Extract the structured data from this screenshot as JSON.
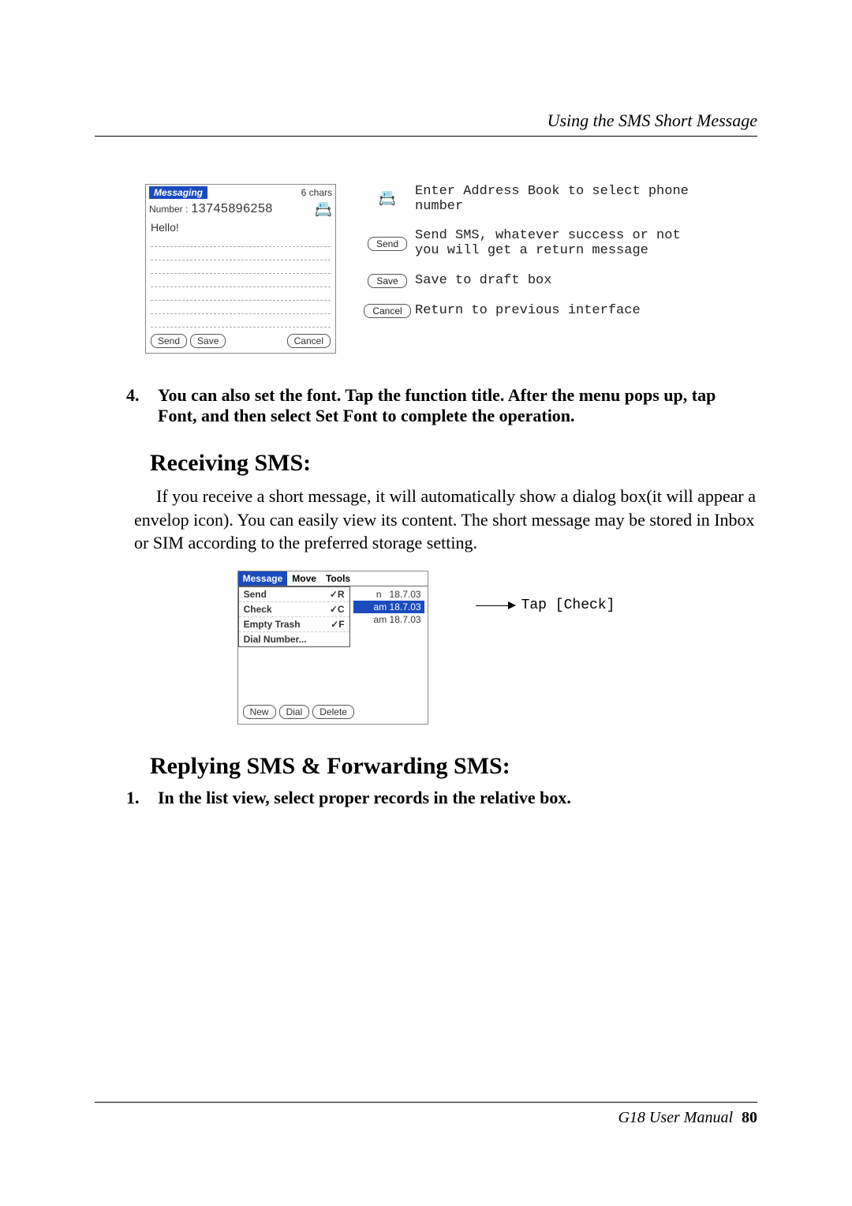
{
  "header": {
    "title": "Using the SMS Short Message"
  },
  "fig1": {
    "title": "Messaging",
    "chars": "6 chars",
    "number_label": "Number :",
    "number_value": "13745896258",
    "body_text": "Hello!",
    "btn_send": "Send",
    "btn_save": "Save",
    "btn_cancel": "Cancel"
  },
  "callouts": {
    "addr": "Enter Address Book to select phone number",
    "send": "Send SMS, whatever success or not you will get a return message",
    "save": "Save to draft box",
    "cancel": "Return to previous interface"
  },
  "step4": {
    "num": "4.",
    "text": "You can also set the font. Tap the function title. After the menu pops up, tap Font, and then select Set Font to complete the operation."
  },
  "h_receiving": "Receiving SMS:",
  "para_receiving": "If you receive a short message, it will automatically show a dialog box(it will appear a envelop icon). You can easily view its content. The short message may be stored in Inbox or SIM according to the preferred storage setting.",
  "fig2": {
    "menu": {
      "message": "Message",
      "move": "Move",
      "tools": "Tools"
    },
    "dropdown": {
      "send": "Send",
      "send_key": "✓R",
      "check": "Check",
      "check_key": "✓C",
      "empty": "Empty Trash",
      "empty_key": "✓F",
      "dial": "Dial Number..."
    },
    "rows": {
      "r1_a": "n",
      "r1_b": "18.7.03",
      "r2_a": "am 18.7.03",
      "r3_a": "am 18.7.03"
    },
    "btn_new": "New",
    "btn_dial": "Dial",
    "btn_delete": "Delete"
  },
  "tap_check": "Tap [Check]",
  "h_replying": "Replying SMS & Forwarding SMS:",
  "step1": {
    "num": "1.",
    "text": "In the list view, select proper records in the relative box."
  },
  "footer": {
    "manual": "G18 User Manual",
    "page": "80"
  }
}
